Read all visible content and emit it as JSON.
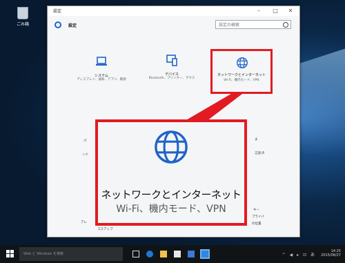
{
  "desktop": {
    "recycle_label": "ごみ箱"
  },
  "window": {
    "title": "設定",
    "header_label": "設定",
    "search_placeholder": "設定の検索",
    "controls": {
      "minimize": "–",
      "maximize": "□",
      "close": "✕"
    }
  },
  "tiles": {
    "system": {
      "name": "システム",
      "desc": "ディスプレイ、通知、アプリ、電源"
    },
    "devices": {
      "name": "デバイス",
      "desc": "Bluetooth、プリンター、マウス"
    },
    "network": {
      "name": "ネットワークとインターネット",
      "desc": "Wi-Fi、機内モード、VPN"
    }
  },
  "fragments": {
    "left1": "パ",
    "left2": "ンド",
    "right1": "ま",
    "right2": "言語",
    "right3": "声",
    "right4": "キー",
    "right5": "プライバ",
    "right6": "の位置",
    "bottom_left": "アレ",
    "bottom_mid": "コスアップ"
  },
  "highlight": {
    "title": "ネットワークとインターネット",
    "desc": "Wi-Fi、機内モード、VPN"
  },
  "taskbar": {
    "search_text": "Web と Windows を検索",
    "time": "14:25",
    "date": "2015/08/27",
    "tray_icons": "^ ◀ ▸ ⊡ あ"
  },
  "colors": {
    "accent": "#1f64c8",
    "highlight": "#e21b22"
  }
}
